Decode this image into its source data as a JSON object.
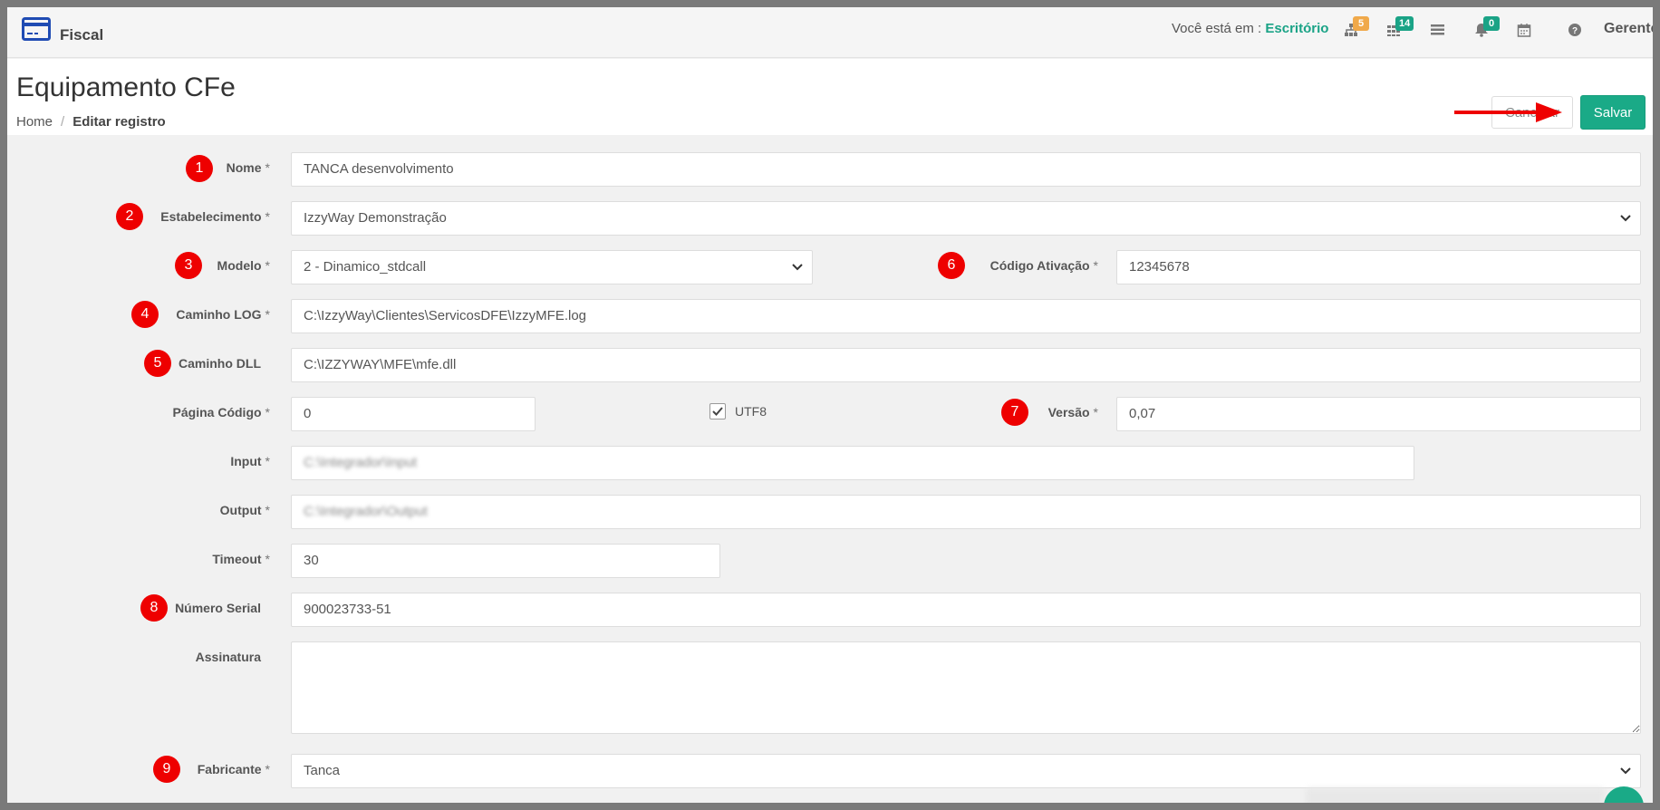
{
  "app": {
    "name": "Fiscal"
  },
  "topbar": {
    "location_prefix": "Você está em :",
    "location": "Escritório",
    "icons": [
      {
        "name": "sitemap-icon",
        "badge": "5",
        "badge_color": "#f0a94a"
      },
      {
        "name": "grid-icon",
        "badge": "14",
        "badge_color": "#1aa386"
      },
      {
        "name": "list-icon",
        "badge": "",
        "badge_color": ""
      },
      {
        "name": "bell-icon",
        "badge": "0",
        "badge_color": "#1aa386"
      },
      {
        "name": "calendar-icon",
        "badge": "",
        "badge_color": ""
      },
      {
        "name": "help-icon",
        "badge": "",
        "badge_color": ""
      }
    ],
    "user": "Gerente"
  },
  "page": {
    "title": "Equipamento CFe",
    "breadcrumb": [
      "Home",
      "Editar registro"
    ],
    "cancel_label": "Cancelar",
    "save_label": "Salvar"
  },
  "form": {
    "nome": {
      "label": "Nome",
      "required": "*",
      "value": "TANCA desenvolvimento",
      "marker": "1"
    },
    "estabelecimento": {
      "label": "Estabelecimento",
      "required": "*",
      "value": "IzzyWay Demonstração",
      "marker": "2"
    },
    "modelo": {
      "label": "Modelo",
      "required": "*",
      "value": "2 - Dinamico_stdcall",
      "marker": "3"
    },
    "codigo_ativacao": {
      "label": "Código Ativação",
      "required": "*",
      "value": "12345678",
      "marker": "6"
    },
    "caminho_log": {
      "label": "Caminho LOG",
      "required": "*",
      "value": "C:\\IzzyWay\\Clientes\\ServicosDFE\\IzzyMFE.log",
      "marker": "4"
    },
    "caminho_dll": {
      "label": "Caminho DLL",
      "value": "C:\\IZZYWAY\\MFE\\mfe.dll",
      "marker": "5"
    },
    "pagina_codigo": {
      "label": "Página Código",
      "required": "*",
      "value": "0"
    },
    "utf8": {
      "label": "UTF8",
      "checked": true
    },
    "versao": {
      "label": "Versão",
      "required": "*",
      "value": "0,07",
      "marker": "7"
    },
    "input": {
      "label": "Input",
      "required": "*",
      "value": "C:\\Integrador\\Input"
    },
    "output": {
      "label": "Output",
      "required": "*",
      "value": "C:\\Integrador\\Output"
    },
    "timeout": {
      "label": "Timeout",
      "required": "*",
      "value": "30"
    },
    "numero_serial": {
      "label": "Número Serial",
      "value": "900023733-51",
      "marker": "8"
    },
    "assinatura": {
      "label": "Assinatura",
      "value": ""
    },
    "fabricante": {
      "label": "Fabricante",
      "required": "*",
      "value": "Tanca",
      "marker": "9"
    }
  },
  "colors": {
    "accent": "#1aaa87",
    "marker": "#ee0000",
    "arrow": "#ee0000"
  }
}
